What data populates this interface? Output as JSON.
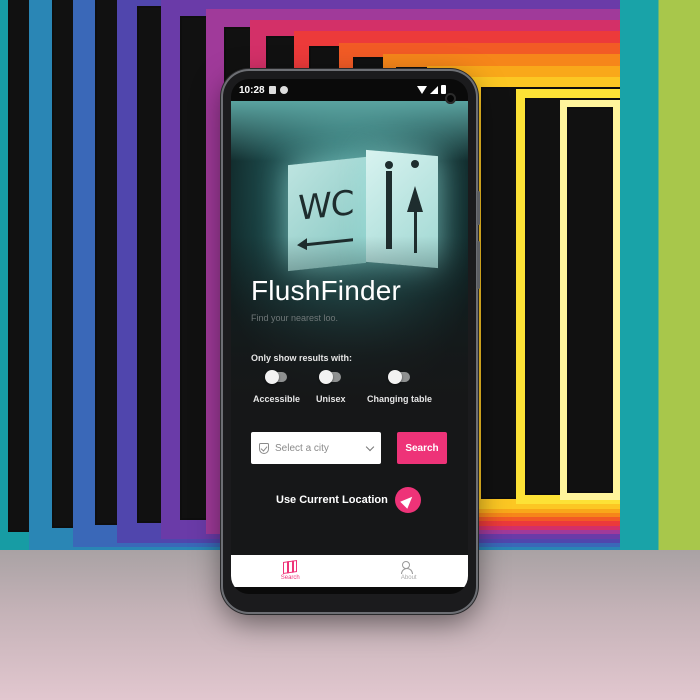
{
  "status_bar": {
    "time": "10:28"
  },
  "app": {
    "name": "FlushFinder",
    "tagline": "Find your nearest loo.",
    "sign_text": "WC"
  },
  "filters": {
    "label": "Only show results with:",
    "options": [
      {
        "label": "Accessible",
        "enabled": false
      },
      {
        "label": "Unisex",
        "enabled": false
      },
      {
        "label": "Changing table",
        "enabled": false
      }
    ]
  },
  "city_select": {
    "placeholder": "Select a city",
    "icon": "shield-check-icon"
  },
  "search_button": {
    "label": "Search"
  },
  "location": {
    "label": "Use Current Location",
    "icon": "navigation-arrow-icon"
  },
  "bottom_nav": {
    "items": [
      {
        "label": "Search",
        "icon": "map-icon",
        "active": true
      },
      {
        "label": "About",
        "icon": "people-icon",
        "active": false
      }
    ]
  },
  "colors": {
    "accent": "#ee3378",
    "screen_bg": "#161718",
    "nav_bg": "#ffffff"
  }
}
